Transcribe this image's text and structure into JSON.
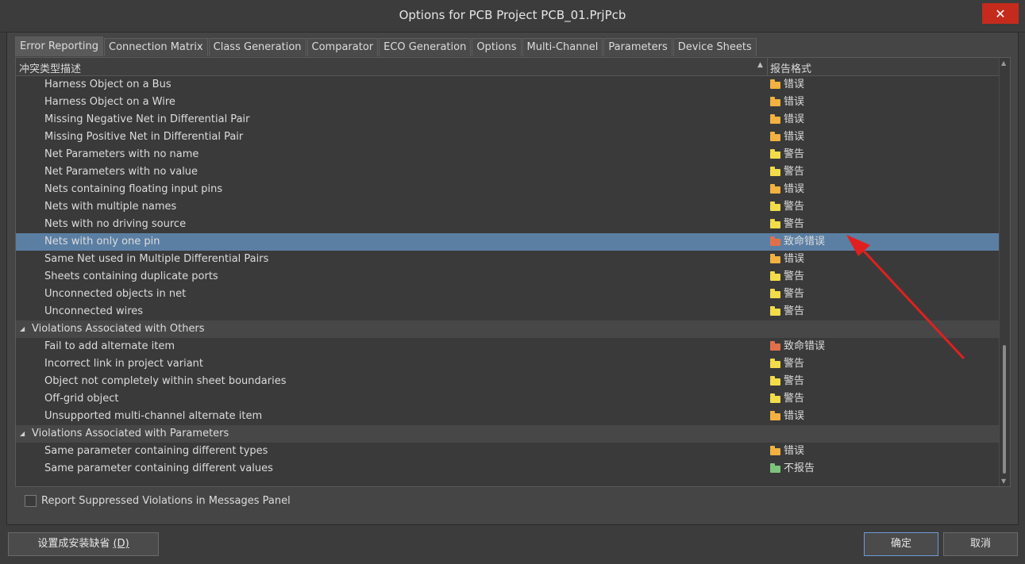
{
  "window": {
    "title": "Options for PCB Project PCB_01.PrjPcb",
    "close_glyph": "✕"
  },
  "tabs": [
    "Error Reporting",
    "Connection Matrix",
    "Class Generation",
    "Comparator",
    "ECO Generation",
    "Options",
    "Multi-Channel",
    "Parameters",
    "Device Sheets"
  ],
  "active_tab": "Error Reporting",
  "table": {
    "col_description": "冲突类型描述",
    "col_report": "报告格式",
    "rows": [
      {
        "type": "item",
        "name": "Harness Object on a Bus",
        "report": "错误",
        "level": "error"
      },
      {
        "type": "item",
        "name": "Harness Object on a Wire",
        "report": "错误",
        "level": "error"
      },
      {
        "type": "item",
        "name": "Missing Negative Net in Differential Pair",
        "report": "错误",
        "level": "error"
      },
      {
        "type": "item",
        "name": "Missing Positive Net in Differential Pair",
        "report": "错误",
        "level": "error"
      },
      {
        "type": "item",
        "name": "Net Parameters with no name",
        "report": "警告",
        "level": "warning"
      },
      {
        "type": "item",
        "name": "Net Parameters with no value",
        "report": "警告",
        "level": "warning"
      },
      {
        "type": "item",
        "name": "Nets containing floating input pins",
        "report": "错误",
        "level": "error"
      },
      {
        "type": "item",
        "name": "Nets with multiple names",
        "report": "警告",
        "level": "warning"
      },
      {
        "type": "item",
        "name": "Nets with no driving source",
        "report": "警告",
        "level": "warning"
      },
      {
        "type": "item",
        "name": "Nets with only one pin",
        "report": "致命错误",
        "level": "fatal",
        "selected": true
      },
      {
        "type": "item",
        "name": "Same Net used in Multiple Differential Pairs",
        "report": "错误",
        "level": "error"
      },
      {
        "type": "item",
        "name": "Sheets containing duplicate ports",
        "report": "警告",
        "level": "warning"
      },
      {
        "type": "item",
        "name": "Unconnected objects in net",
        "report": "警告",
        "level": "warning"
      },
      {
        "type": "item",
        "name": "Unconnected wires",
        "report": "警告",
        "level": "warning"
      },
      {
        "type": "group",
        "name": "Violations Associated with Others"
      },
      {
        "type": "item",
        "name": "Fail to add alternate item",
        "report": "致命错误",
        "level": "fatal"
      },
      {
        "type": "item",
        "name": "Incorrect link in project variant",
        "report": "警告",
        "level": "warning"
      },
      {
        "type": "item",
        "name": "Object not completely within sheet boundaries",
        "report": "警告",
        "level": "warning"
      },
      {
        "type": "item",
        "name": "Off-grid object",
        "report": "警告",
        "level": "warning"
      },
      {
        "type": "item",
        "name": "Unsupported multi-channel alternate item",
        "report": "错误",
        "level": "error"
      },
      {
        "type": "group",
        "name": "Violations Associated with Parameters"
      },
      {
        "type": "item",
        "name": "Same parameter containing different types",
        "report": "错误",
        "level": "error"
      },
      {
        "type": "item",
        "name": "Same parameter containing different values",
        "report": "不报告",
        "level": "none"
      }
    ]
  },
  "level_colors": {
    "error": "#f2b140",
    "warning": "#f3dc4a",
    "fatal": "#e0704a",
    "none": "#7cc47c"
  },
  "checkbox": {
    "label": "Report Suppressed Violations in Messages Panel",
    "checked": false
  },
  "buttons": {
    "defaults": "设置成安装缺省 ",
    "defaults_key": "(D)",
    "ok": "确定",
    "cancel": "取消"
  }
}
